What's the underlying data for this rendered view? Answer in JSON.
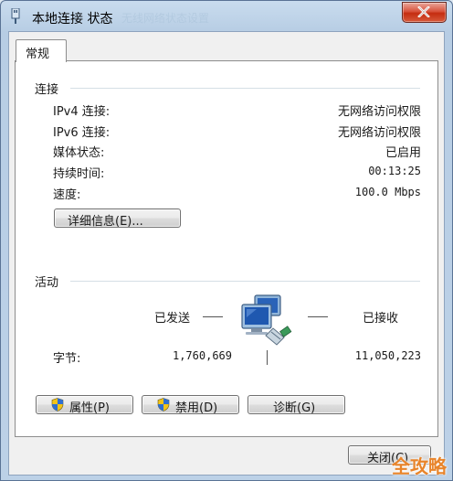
{
  "window": {
    "title": "本地连接 状态",
    "ghost_title": "无线网络状态设置"
  },
  "tab": {
    "label": "常规"
  },
  "connection": {
    "heading": "连接",
    "rows": [
      {
        "label": "IPv4 连接:",
        "value": "无网络访问权限"
      },
      {
        "label": "IPv6 连接:",
        "value": "无网络访问权限"
      },
      {
        "label": "媒体状态:",
        "value": "已启用"
      },
      {
        "label": "持续时间:",
        "value": "00:13:25"
      },
      {
        "label": "速度:",
        "value": "100.0 Mbps"
      }
    ],
    "details_button": "详细信息(E)..."
  },
  "activity": {
    "heading": "活动",
    "sent_label": "已发送",
    "received_label": "已接收",
    "bytes_label": "字节:",
    "bytes_sent": "1,760,669",
    "bytes_received": "11,050,223"
  },
  "actions": {
    "properties": "属性(P)",
    "disable": "禁用(D)",
    "diagnose": "诊断(G)"
  },
  "footer": {
    "close": "关闭(C)"
  },
  "watermark": "全攻略",
  "icons": {
    "app": "network-adapter-icon",
    "shield": "uac-shield-icon",
    "activity": "network-computers-icon"
  }
}
